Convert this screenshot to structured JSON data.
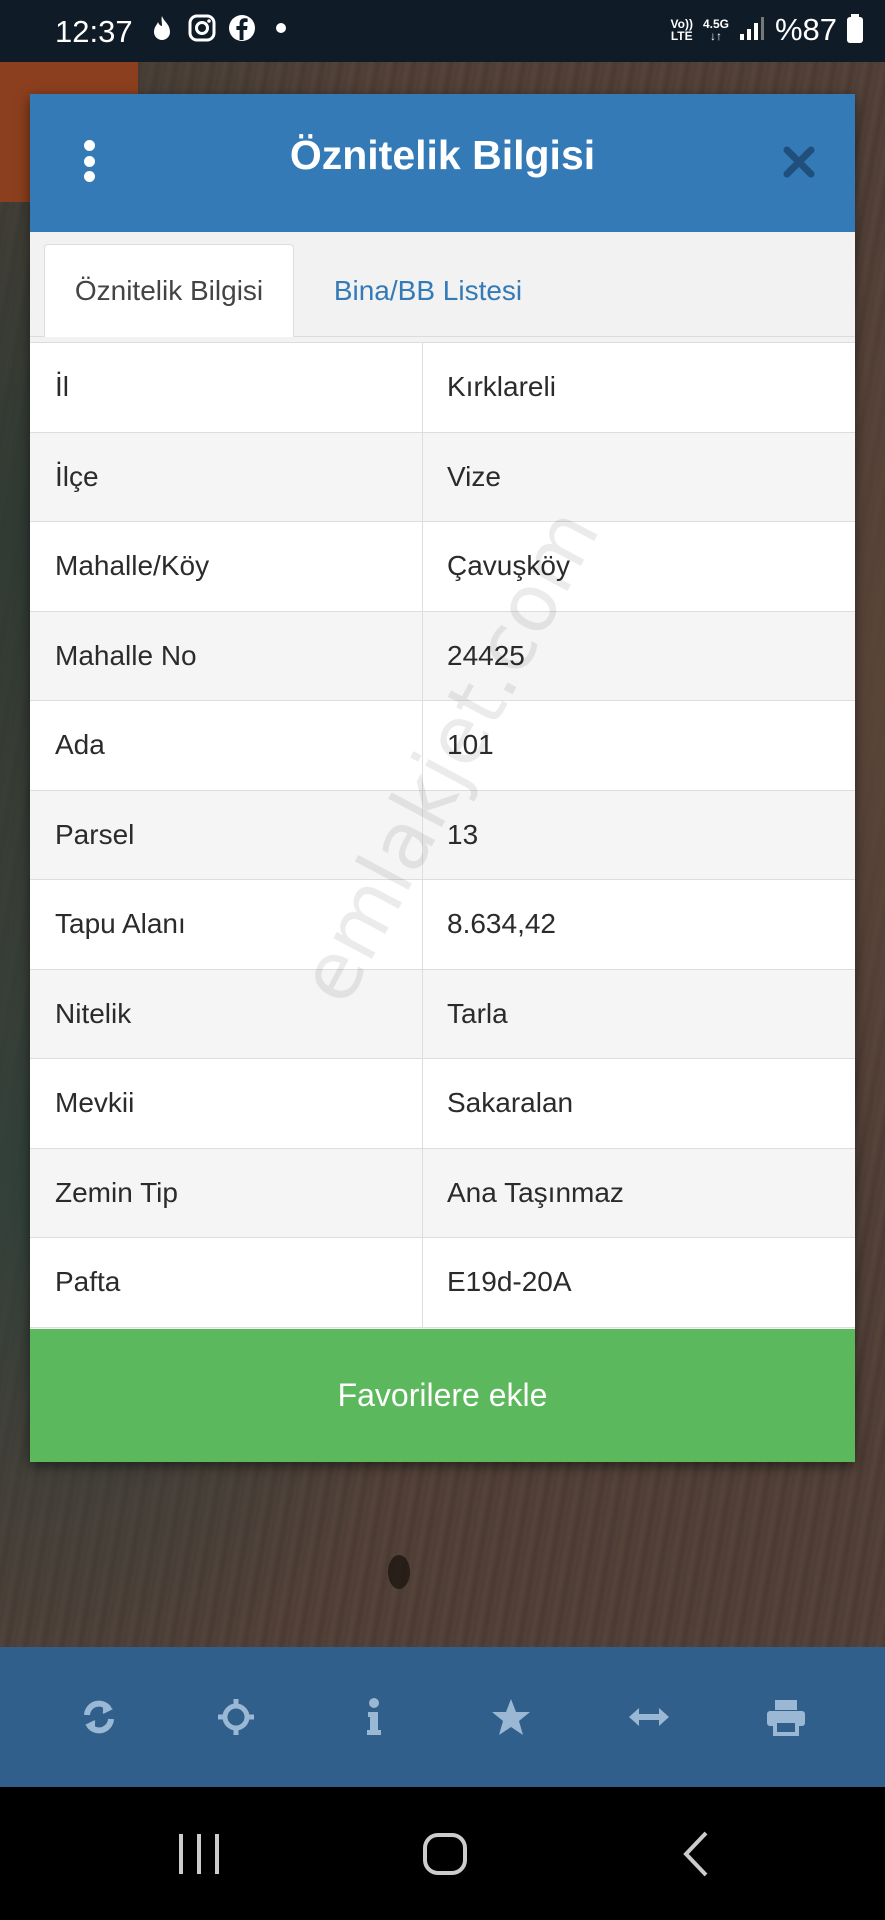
{
  "status_bar": {
    "time": "12:37",
    "network_top": "Vo))",
    "network_bottom": "LTE",
    "signal_type": "4.5G",
    "battery": "%87"
  },
  "modal": {
    "title": "Öznitelik Bilgisi",
    "tabs": [
      {
        "label": "Öznitelik Bilgisi",
        "active": true
      },
      {
        "label": "Bina/BB Listesi",
        "active": false
      }
    ],
    "rows": [
      {
        "key": "İl",
        "value": "Kırklareli"
      },
      {
        "key": "İlçe",
        "value": "Vize"
      },
      {
        "key": "Mahalle/Köy",
        "value": "Çavuşköy"
      },
      {
        "key": "Mahalle No",
        "value": "24425"
      },
      {
        "key": "Ada",
        "value": "101"
      },
      {
        "key": "Parsel",
        "value": "13"
      },
      {
        "key": "Tapu Alanı",
        "value": "8.634,42"
      },
      {
        "key": "Nitelik",
        "value": "Tarla"
      },
      {
        "key": "Mevkii",
        "value": "Sakaralan"
      },
      {
        "key": "Zemin Tip",
        "value": "Ana Taşınmaz"
      },
      {
        "key": "Pafta",
        "value": "E19d-20A"
      }
    ],
    "watermark": "emlakjet.com",
    "favorite_label": "Favorilere ekle"
  },
  "toolbar": {
    "items": [
      "refresh-icon",
      "locate-icon",
      "info-icon",
      "star-icon",
      "measure-icon",
      "print-icon"
    ]
  },
  "colors": {
    "header": "#337ab7",
    "button": "#5cb85c",
    "toolbar": "#2f5f8a",
    "toolbar_icon": "#9ab8d4"
  }
}
